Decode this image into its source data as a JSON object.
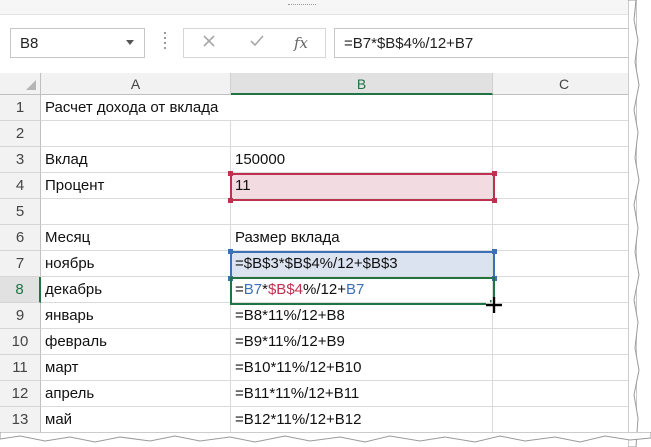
{
  "name_box": {
    "value": "B8"
  },
  "formula_bar": {
    "cancel_icon": "close-icon",
    "enter_icon": "check-icon",
    "fx_label": "fx",
    "value": "=B7*$B$4%/12+B7"
  },
  "columns": [
    "A",
    "B",
    "C"
  ],
  "rows": [
    {
      "num": "1",
      "a": "Расчет дохода от вклада",
      "b": ""
    },
    {
      "num": "2",
      "a": "",
      "b": ""
    },
    {
      "num": "3",
      "a": "Вклад",
      "b": "150000"
    },
    {
      "num": "4",
      "a": "Процент",
      "b": "11"
    },
    {
      "num": "5",
      "a": "",
      "b": ""
    },
    {
      "num": "6",
      "a": "Месяц",
      "b": "Размер вклада"
    },
    {
      "num": "7",
      "a": "ноябрь",
      "b": "=$B$3*$B$4%/12+$B$3"
    },
    {
      "num": "8",
      "a": "декабрь",
      "b": "=B7*$B$4%/12+B7"
    },
    {
      "num": "9",
      "a": "январь",
      "b": "=B8*11%/12+B8"
    },
    {
      "num": "10",
      "a": "февраль",
      "b": "=B9*11%/12+B9"
    },
    {
      "num": "11",
      "a": "март",
      "b": "=B10*11%/12+B10"
    },
    {
      "num": "12",
      "a": "апрель",
      "b": "=B11*11%/12+B11"
    },
    {
      "num": "13",
      "a": "май",
      "b": "=B12*11%/12+B12"
    }
  ],
  "edit_formula_parts": [
    {
      "text": "=",
      "tone": "plain"
    },
    {
      "text": "B7",
      "tone": "blue"
    },
    {
      "text": "*",
      "tone": "plain"
    },
    {
      "text": "$B$4",
      "tone": "red"
    },
    {
      "text": "%/12+",
      "tone": "plain"
    },
    {
      "text": "B7",
      "tone": "blue"
    }
  ],
  "colors": {
    "excel_green": "#217346",
    "ref_red": "#c0304f",
    "ref_blue": "#3c6fb5",
    "ref_red_fill": "#f2dbe1",
    "ref_blue_fill": "#dce3f0"
  }
}
